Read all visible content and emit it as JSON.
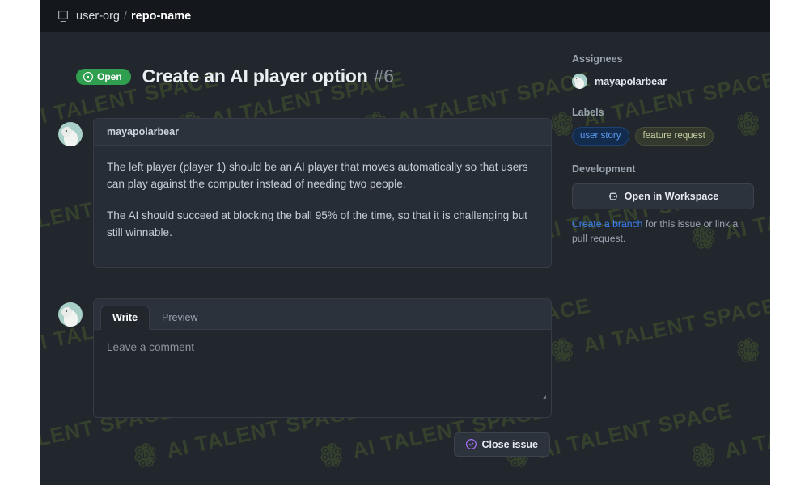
{
  "repo_bar": {
    "icon": "repo-icon",
    "owner": "user-org",
    "separator": "/",
    "name": "repo-name"
  },
  "issue": {
    "state_badge": {
      "label": "Open",
      "icon": "issue-opened-icon",
      "color": "#2f9e4f"
    },
    "title": "Create an AI player option",
    "number": "#6"
  },
  "comment": {
    "author": "mayapolarbear",
    "avatar_icon": "polar-bear-avatar",
    "paragraphs": [
      "The left player (player 1) should be an AI player that moves automatically so that users can play against the computer instead of needing two people.",
      "The AI should succeed at blocking the ball 95% of the time, so that it is challenging but still winnable."
    ]
  },
  "composer": {
    "avatar_icon": "polar-bear-avatar",
    "tabs": [
      {
        "label": "Write",
        "active": true
      },
      {
        "label": "Preview",
        "active": false
      }
    ],
    "tab_write": "Write",
    "tab_preview": "Preview",
    "placeholder": "Leave a comment",
    "value": ""
  },
  "actions": {
    "close_issue_label": "Close issue",
    "close_issue_icon": "check-circle-icon",
    "close_issue_icon_color": "#a371f7"
  },
  "sidebar": {
    "assignees": {
      "title": "Assignees",
      "people": [
        {
          "name": "mayapolarbear",
          "avatar_icon": "polar-bear-avatar"
        }
      ]
    },
    "labels": {
      "title": "Labels",
      "items": [
        {
          "name": "user story",
          "color": "#5b9cf0",
          "background": "#132b4d"
        },
        {
          "name": "feature request",
          "color": "#c9cfa5",
          "background": "#33392c"
        }
      ]
    },
    "development": {
      "title": "Development",
      "open_workspace_label": "Open in Workspace",
      "open_workspace_icon": "copilot-workspace-icon",
      "hint_link": "Create a branch",
      "hint_rest": " for this issue or link a pull request."
    }
  },
  "watermark": {
    "text": "AI TALENT SPACE",
    "icon": "brain-network-icon",
    "color": "#44582c"
  },
  "theme": {
    "page_background": "#22272e",
    "header_background": "#14181d",
    "card_background": "#272d36",
    "border": "#353c45",
    "text_primary": "#e9eef3",
    "text_secondary": "#9aa4af",
    "accent_green": "#2f9e4f",
    "accent_blue": "#3b82f6",
    "accent_purple": "#a371f7"
  }
}
